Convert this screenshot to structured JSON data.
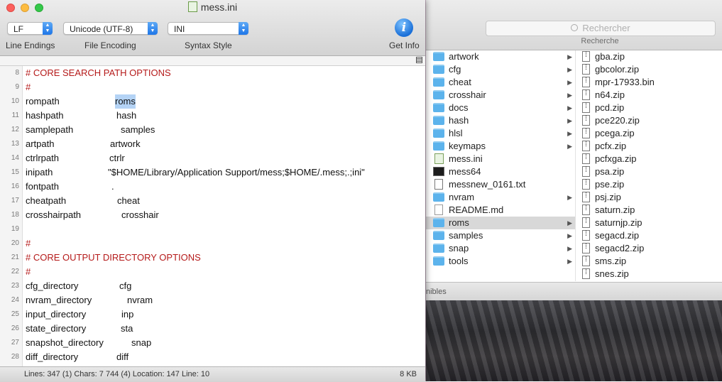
{
  "editor": {
    "title": "mess.ini",
    "toolbar": {
      "line_endings": {
        "value": "LF",
        "label": "Line Endings"
      },
      "file_encoding": {
        "value": "Unicode (UTF-8)",
        "label": "File Encoding"
      },
      "syntax_style": {
        "value": "INI",
        "label": "Syntax Style"
      },
      "get_info": {
        "label": "Get Info",
        "glyph": "i"
      }
    },
    "lines": [
      {
        "num": "8",
        "key": "# CORE SEARCH PATH OPTIONS",
        "value": "",
        "comment": true
      },
      {
        "num": "9",
        "key": "#",
        "value": "",
        "comment": true
      },
      {
        "num": "10",
        "key": "rompath",
        "value": "roms",
        "selected": true
      },
      {
        "num": "11",
        "key": "hashpath",
        "value": "hash"
      },
      {
        "num": "12",
        "key": "samplepath",
        "value": "samples"
      },
      {
        "num": "13",
        "key": "artpath",
        "value": "artwork"
      },
      {
        "num": "14",
        "key": "ctrlrpath",
        "value": "ctrlr"
      },
      {
        "num": "15",
        "key": "inipath",
        "value": "\"$HOME/Library/Application Support/mess;$HOME/.mess;.;ini\""
      },
      {
        "num": "16",
        "key": "fontpath",
        "value": "."
      },
      {
        "num": "17",
        "key": "cheatpath",
        "value": "cheat"
      },
      {
        "num": "18",
        "key": "crosshairpath",
        "value": "crosshair"
      },
      {
        "num": "19",
        "key": "",
        "value": ""
      },
      {
        "num": "20",
        "key": "#",
        "value": "",
        "comment": true
      },
      {
        "num": "21",
        "key": "# CORE OUTPUT DIRECTORY OPTIONS",
        "value": "",
        "comment": true
      },
      {
        "num": "22",
        "key": "#",
        "value": "",
        "comment": true
      },
      {
        "num": "23",
        "key": "cfg_directory",
        "value": "cfg"
      },
      {
        "num": "24",
        "key": "nvram_directory",
        "value": "nvram"
      },
      {
        "num": "25",
        "key": "input_directory",
        "value": "inp"
      },
      {
        "num": "26",
        "key": "state_directory",
        "value": "sta"
      },
      {
        "num": "27",
        "key": "snapshot_directory",
        "value": "snap"
      },
      {
        "num": "28",
        "key": "diff_directory",
        "value": "diff"
      }
    ],
    "status": {
      "left": "Lines: 347 (1)   Chars: 7 744 (4)   Location: 147   Line: 10",
      "right": "8 KB"
    }
  },
  "finder": {
    "search": {
      "placeholder": "Rechercher",
      "label": "Recherche"
    },
    "column1": [
      {
        "name": "artwork",
        "icon": "folder-icon",
        "chevron": true
      },
      {
        "name": "cfg",
        "icon": "folder-icon",
        "chevron": true
      },
      {
        "name": "cheat",
        "icon": "folder-icon",
        "chevron": true
      },
      {
        "name": "crosshair",
        "icon": "folder-icon",
        "chevron": true
      },
      {
        "name": "docs",
        "icon": "folder-icon",
        "chevron": true
      },
      {
        "name": "hash",
        "icon": "folder-icon",
        "chevron": true
      },
      {
        "name": "hlsl",
        "icon": "folder-icon",
        "chevron": true
      },
      {
        "name": "keymaps",
        "icon": "folder-icon",
        "chevron": true
      },
      {
        "name": "mess.ini",
        "icon": "ini-file-icon",
        "chevron": false
      },
      {
        "name": "mess64",
        "icon": "terminal-executable-icon",
        "chevron": false
      },
      {
        "name": "messnew_0161.txt",
        "icon": "text-document-icon",
        "chevron": false
      },
      {
        "name": "nvram",
        "icon": "folder-icon",
        "chevron": true
      },
      {
        "name": "README.md",
        "icon": "blank-document-icon",
        "chevron": false
      },
      {
        "name": "roms",
        "icon": "folder-icon",
        "chevron": true,
        "selected": true
      },
      {
        "name": "samples",
        "icon": "folder-icon",
        "chevron": true
      },
      {
        "name": "snap",
        "icon": "folder-icon",
        "chevron": true
      },
      {
        "name": "tools",
        "icon": "folder-icon",
        "chevron": true
      }
    ],
    "column2": [
      "gba.zip",
      "gbcolor.zip",
      "mpr-17933.bin",
      "n64.zip",
      "pcd.zip",
      "pce220.zip",
      "pcega.zip",
      "pcfx.zip",
      "pcfxga.zip",
      "psa.zip",
      "pse.zip",
      "psj.zip",
      "saturn.zip",
      "saturnjp.zip",
      "segacd.zip",
      "segacd2.zip",
      "sms.zip",
      "snes.zip"
    ],
    "status_text": "nibles"
  },
  "colors": {
    "comment": "#b51a1a",
    "selection": "#b4d3f5",
    "folder": "#5cb3ec",
    "popup_accent": "#1e76e8"
  }
}
